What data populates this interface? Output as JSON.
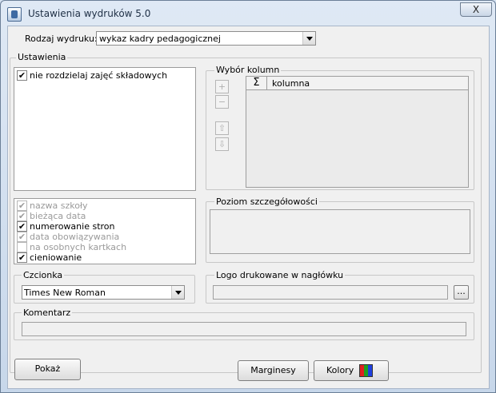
{
  "window": {
    "title": "Ustawienia wydruków 5.0",
    "close_symbol": "X"
  },
  "report_type": {
    "label": "Rodzaj wydruku:",
    "value": "wykaz kadry pedagogicznej"
  },
  "settings": {
    "legend": "Ustawienia",
    "components_list": [
      {
        "label": "nie rozdzielaj zajęć składowych",
        "checked": true,
        "enabled": true
      }
    ],
    "options": [
      {
        "label": "nazwa szkoły",
        "checked": true,
        "enabled": false
      },
      {
        "label": "bieżąca data",
        "checked": true,
        "enabled": false
      },
      {
        "label": "numerowanie stron",
        "checked": true,
        "enabled": true
      },
      {
        "label": "data obowiązywania",
        "checked": true,
        "enabled": false
      },
      {
        "label": "na osobnych kartkach",
        "checked": false,
        "enabled": false
      },
      {
        "label": "cieniowanie",
        "checked": true,
        "enabled": true
      }
    ]
  },
  "columns": {
    "legend": "Wybór kolumn",
    "header_sigma": "Σ",
    "header_label": "kolumna",
    "buttons": {
      "add": "+",
      "remove": "−",
      "up": "⇧",
      "down": "⇩"
    }
  },
  "detail_level": {
    "legend": "Poziom szczegółowości"
  },
  "font": {
    "legend": "Czcionka",
    "value": "Times New Roman"
  },
  "logo": {
    "legend": "Logo drukowane w nagłówku",
    "browse": "..."
  },
  "comment": {
    "legend": "Komentarz"
  },
  "footer": {
    "show": "Pokaż",
    "margins": "Marginesy",
    "colors": "Kolory"
  },
  "colors": {
    "check": "#000000",
    "disabled_text": "#9a9a9a",
    "window_bg": "#f0f0f0"
  }
}
